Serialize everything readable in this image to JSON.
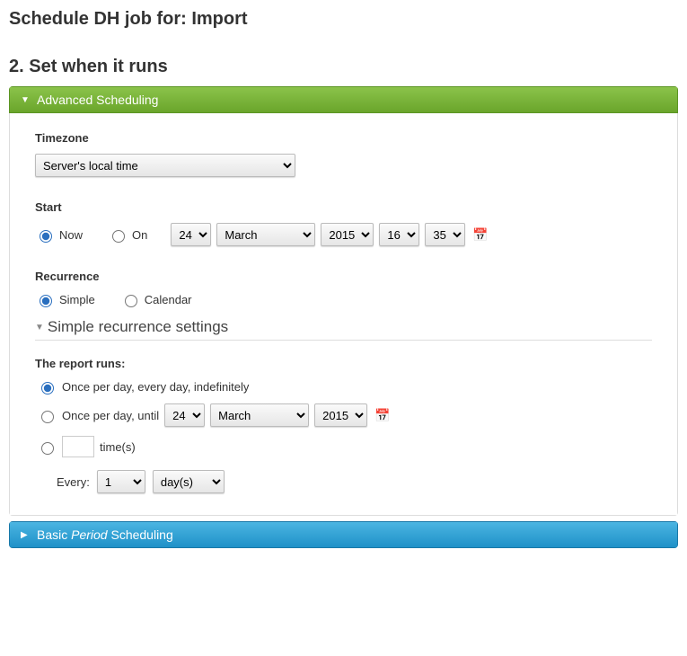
{
  "page": {
    "title": "Schedule DH job for: Import",
    "step_title": "2. Set when it runs"
  },
  "advanced": {
    "header": "Advanced Scheduling",
    "timezone": {
      "label": "Timezone",
      "value": "Server's local time"
    },
    "start": {
      "label": "Start",
      "option_now": "Now",
      "option_on": "On",
      "selected": "now",
      "day": "24",
      "month": "March",
      "year": "2015",
      "hour": "16",
      "minute": "35"
    },
    "recurrence": {
      "label": "Recurrence",
      "option_simple": "Simple",
      "option_calendar": "Calendar",
      "selected": "simple"
    },
    "simple_settings": {
      "header": "Simple recurrence settings",
      "runs_label": "The report runs:",
      "opt_indefinitely": "Once per day, every day, indefinitely",
      "opt_until_prefix": "Once per day, until",
      "until_day": "24",
      "until_month": "March",
      "until_year": "2015",
      "opt_times_suffix": "time(s)",
      "times_value": "",
      "every_label": "Every:",
      "every_count": "1",
      "every_unit": "day(s)",
      "selected": "indefinitely"
    }
  },
  "basic": {
    "header_prefix": "Basic ",
    "header_em": "Period",
    "header_suffix": " Scheduling"
  }
}
